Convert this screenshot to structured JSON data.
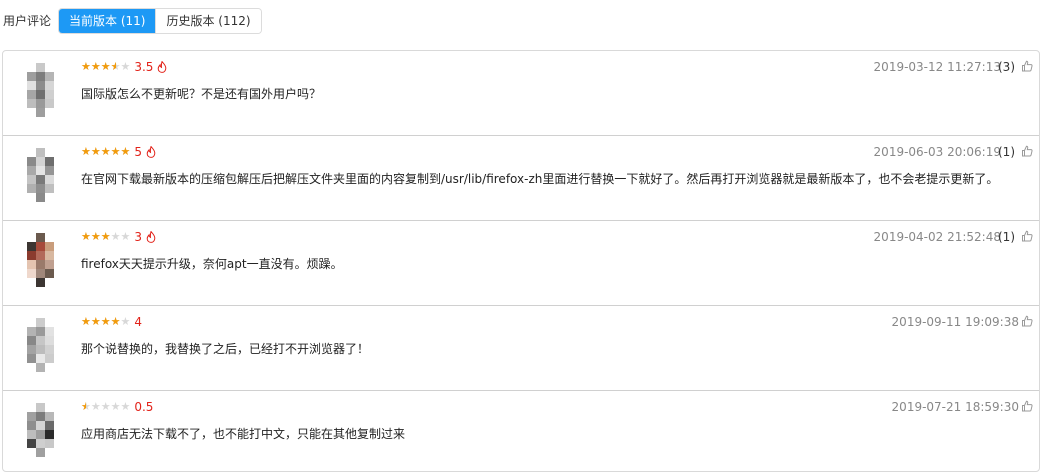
{
  "header": {
    "title": "用户评论",
    "tabs": [
      {
        "label": "当前版本 (11)",
        "active": true
      },
      {
        "label": "历史版本 (112)",
        "active": false
      }
    ]
  },
  "colors": {
    "accent": "#1d99f5",
    "star": "#f29b0b",
    "score": "#e2231a"
  },
  "reviews": [
    {
      "rating": 3.5,
      "score_text": "3.5",
      "hot": true,
      "text": "国际版怎么不更新呢？不是还有国外用户吗？",
      "time": "2019-03-12 11:27:13",
      "likes": "(3)"
    },
    {
      "rating": 5,
      "score_text": "5",
      "hot": true,
      "text": "在官网下载最新版本的压缩包解压后把解压文件夹里面的内容复制到/usr/lib/firefox-zh里面进行替换一下就好了。然后再打开浏览器就是最新版本了，也不会老提示更新了。",
      "time": "2019-06-03 20:06:19",
      "likes": "(1)"
    },
    {
      "rating": 3,
      "score_text": "3",
      "hot": true,
      "text": "firefox天天提示升级，奈何apt一直没有。烦躁。",
      "time": "2019-04-02 21:52:48",
      "likes": "(1)"
    },
    {
      "rating": 4,
      "score_text": "4",
      "hot": false,
      "text": "那个说替换的，我替换了之后，已经打不开浏览器了！",
      "time": "2019-09-11 19:09:38",
      "likes": ""
    },
    {
      "rating": 0.5,
      "score_text": "0.5",
      "hot": false,
      "text": "应用商店无法下载不了，也不能打中文，只能在其他复制过来",
      "time": "2019-07-21 18:59:30",
      "likes": ""
    }
  ]
}
